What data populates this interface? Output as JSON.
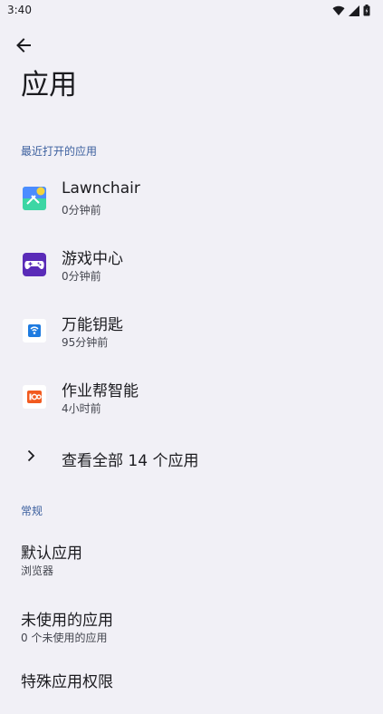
{
  "status_bar": {
    "time": "3:40",
    "icons": [
      "wifi-icon",
      "signal-icon",
      "battery-icon"
    ]
  },
  "header": {
    "back_icon": "arrow-back-icon",
    "title": "应用"
  },
  "recent": {
    "section_label": "最近打开的应用",
    "apps": [
      {
        "name": "Lawnchair",
        "subtitle": "0分钟前",
        "icon": "lawnchair-icon"
      },
      {
        "name": "游戏中心",
        "subtitle": "0分钟前",
        "icon": "game-center-icon"
      },
      {
        "name": "万能钥匙",
        "subtitle": "95分钟前",
        "icon": "wifi-key-icon"
      },
      {
        "name": "作业帮智能",
        "subtitle": "4小时前",
        "icon": "zuoyebang-icon"
      }
    ],
    "see_all_label": "查看全部 14 个应用"
  },
  "general": {
    "section_label": "常规",
    "items": [
      {
        "title": "默认应用",
        "subtitle": "浏览器"
      },
      {
        "title": "未使用的应用",
        "subtitle": "0 个未使用的应用"
      },
      {
        "title": "特殊应用权限",
        "subtitle": ""
      }
    ]
  },
  "colors": {
    "background": "#f1f0f6",
    "accent": "#3b5f9e"
  }
}
